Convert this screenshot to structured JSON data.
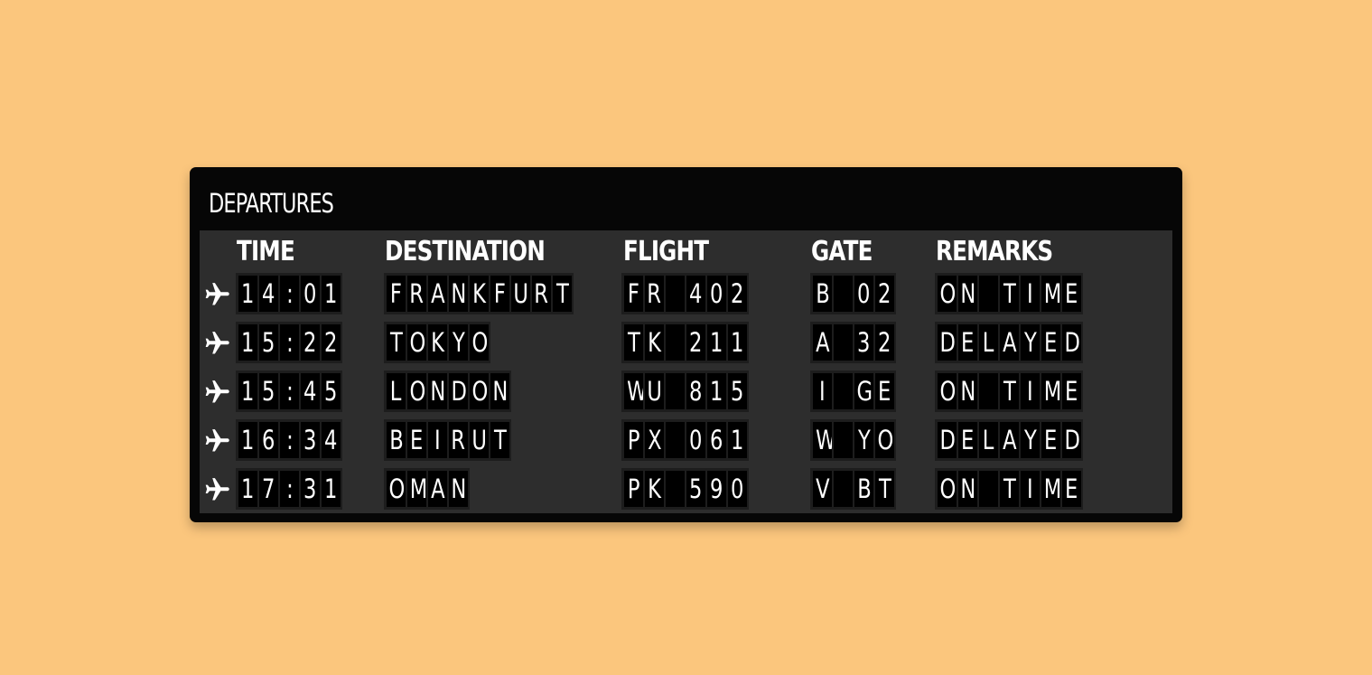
{
  "board": {
    "title": "DEPARTURES",
    "headers": {
      "time": "TIME",
      "destination": "DESTINATION",
      "flight": "FLIGHT",
      "gate": "GATE",
      "remarks": "REMARKS"
    },
    "icon": "airplane-icon",
    "rows": [
      {
        "time": "14:01",
        "destination": "FRANKFURT",
        "flight": "FR 402",
        "gate": "B 02",
        "remarks": "ON TIME"
      },
      {
        "time": "15:22",
        "destination": "TOKYO",
        "flight": "TK 211",
        "gate": "A 32",
        "remarks": "DELAYED"
      },
      {
        "time": "15:45",
        "destination": "LONDON",
        "flight": "WU 815",
        "gate": "I GE",
        "remarks": "ON TIME"
      },
      {
        "time": "16:34",
        "destination": "BEIRUT",
        "flight": "PX 061",
        "gate": "W YO",
        "remarks": "DELAYED"
      },
      {
        "time": "17:31",
        "destination": "OMAN",
        "flight": "PK 590",
        "gate": "V BT",
        "remarks": "ON TIME"
      }
    ]
  },
  "colors": {
    "background": "#FBC67D",
    "board": "#060606",
    "panel": "#2d2d2d",
    "text": "#ffffff"
  }
}
